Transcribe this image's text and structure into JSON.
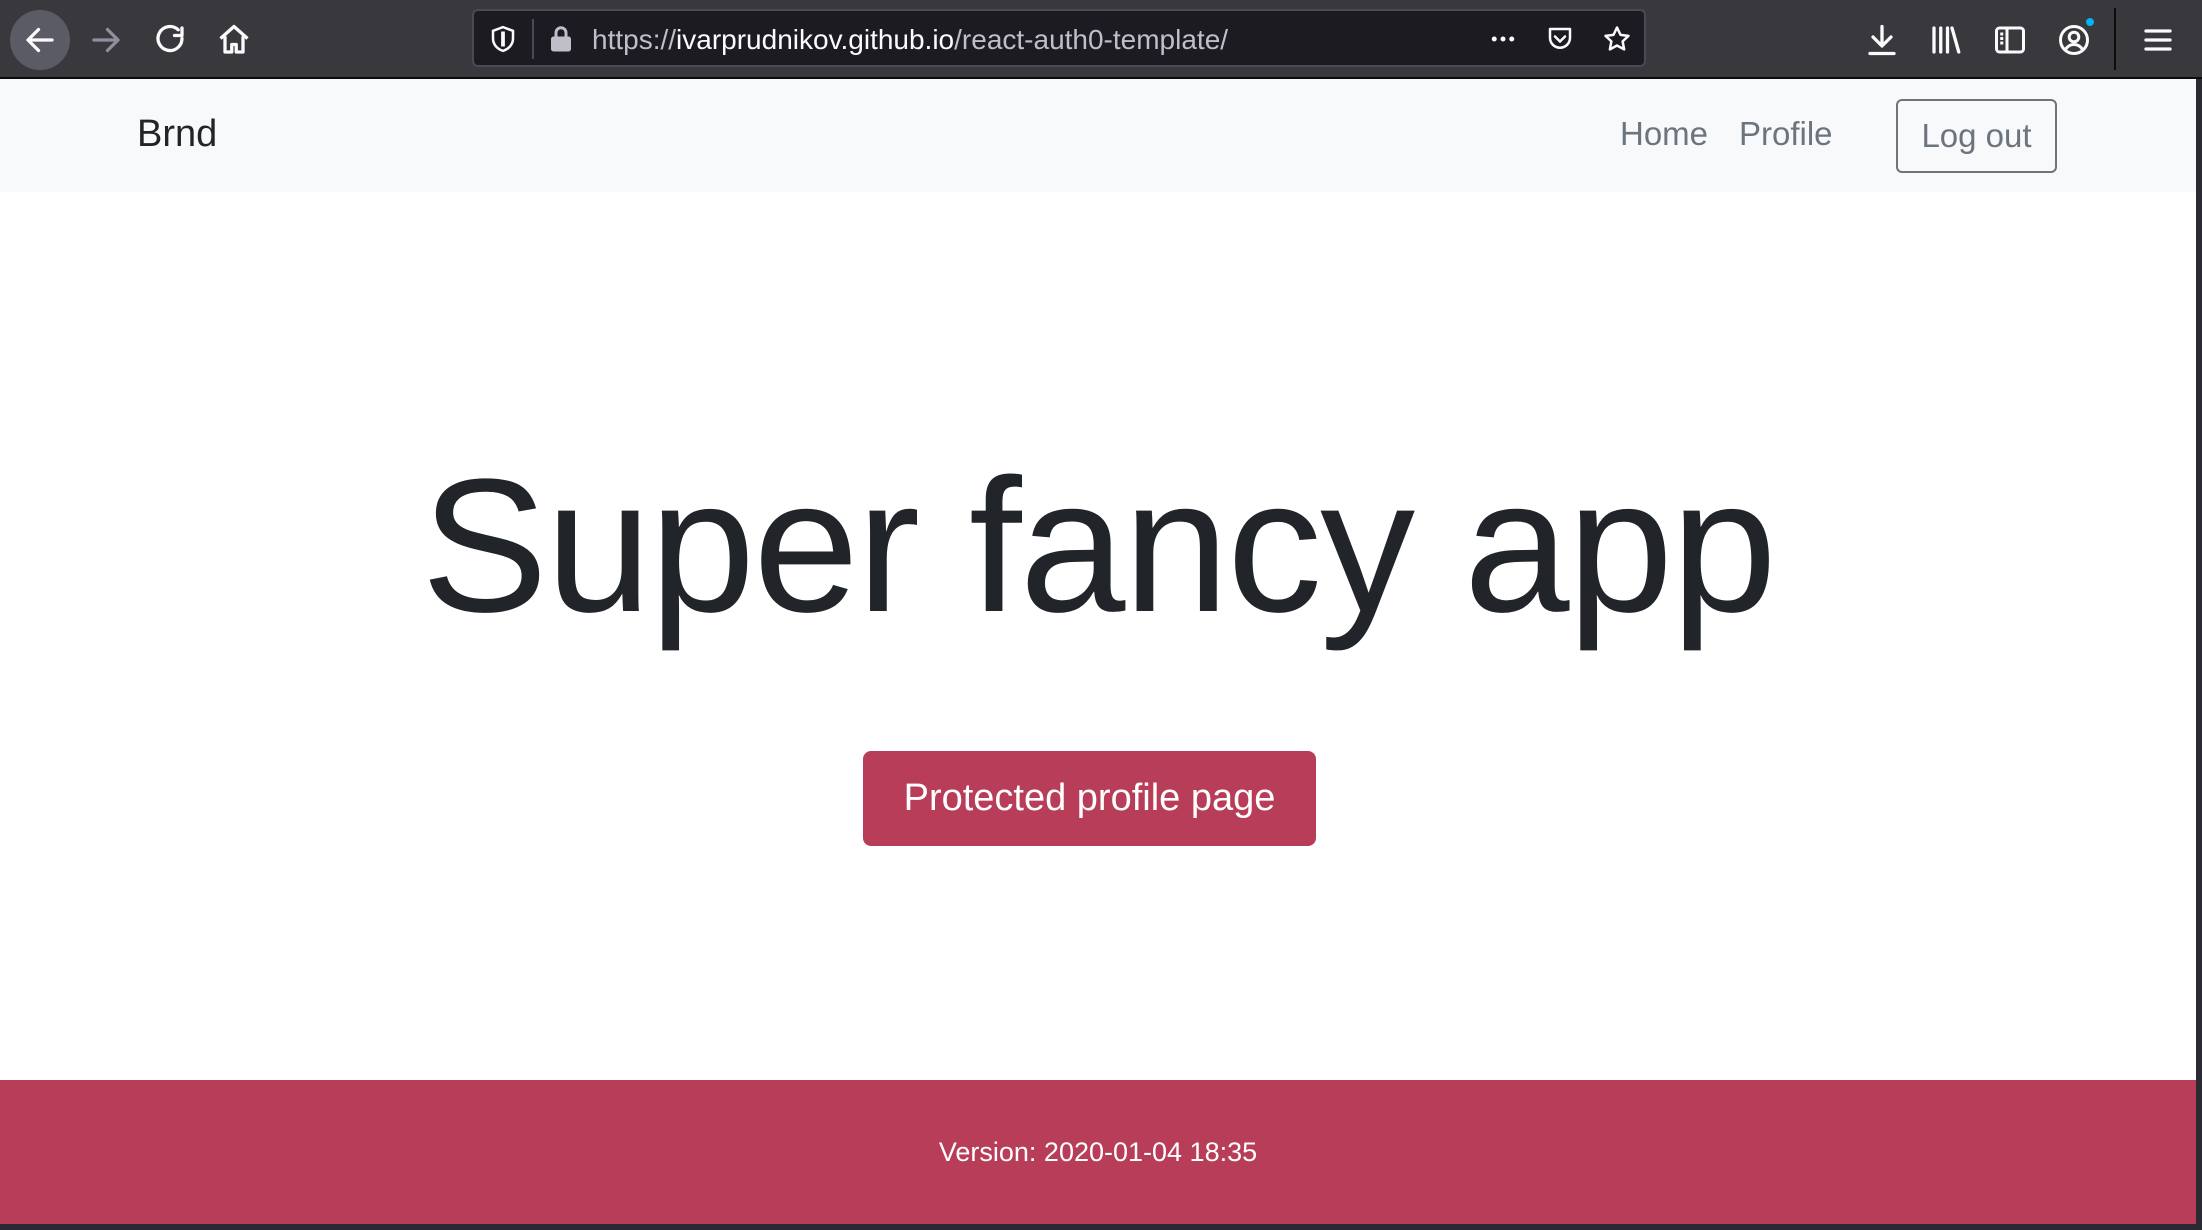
{
  "browser": {
    "url": {
      "scheme": "https://",
      "host": "ivarprudnikov.github.io",
      "path": "/react-auth0-template/"
    },
    "icons": {
      "back": "arrow-left-icon",
      "forward": "arrow-right-icon",
      "reload": "reload-icon",
      "home": "home-icon",
      "tracking": "shield-icon",
      "lock": "lock-icon",
      "page_actions": "more-horizontal-icon",
      "pocket": "pocket-icon",
      "bookmark": "star-icon",
      "downloads": "download-icon",
      "library": "library-icon",
      "sidebar": "sidebar-icon",
      "account": "account-icon",
      "menu": "hamburger-menu-icon"
    }
  },
  "navbar": {
    "brand": "Brnd",
    "links": [
      {
        "label": "Home"
      },
      {
        "label": "Profile"
      }
    ],
    "logout_label": "Log out"
  },
  "hero": {
    "title": "Super fancy app",
    "cta_label": "Protected profile page"
  },
  "footer": {
    "version_text": "Version: 2020-01-04 18:35"
  },
  "colors": {
    "accent": "#b83d59",
    "navbar_bg": "#f8f9fa",
    "text": "#212529",
    "muted": "#6c757d"
  }
}
